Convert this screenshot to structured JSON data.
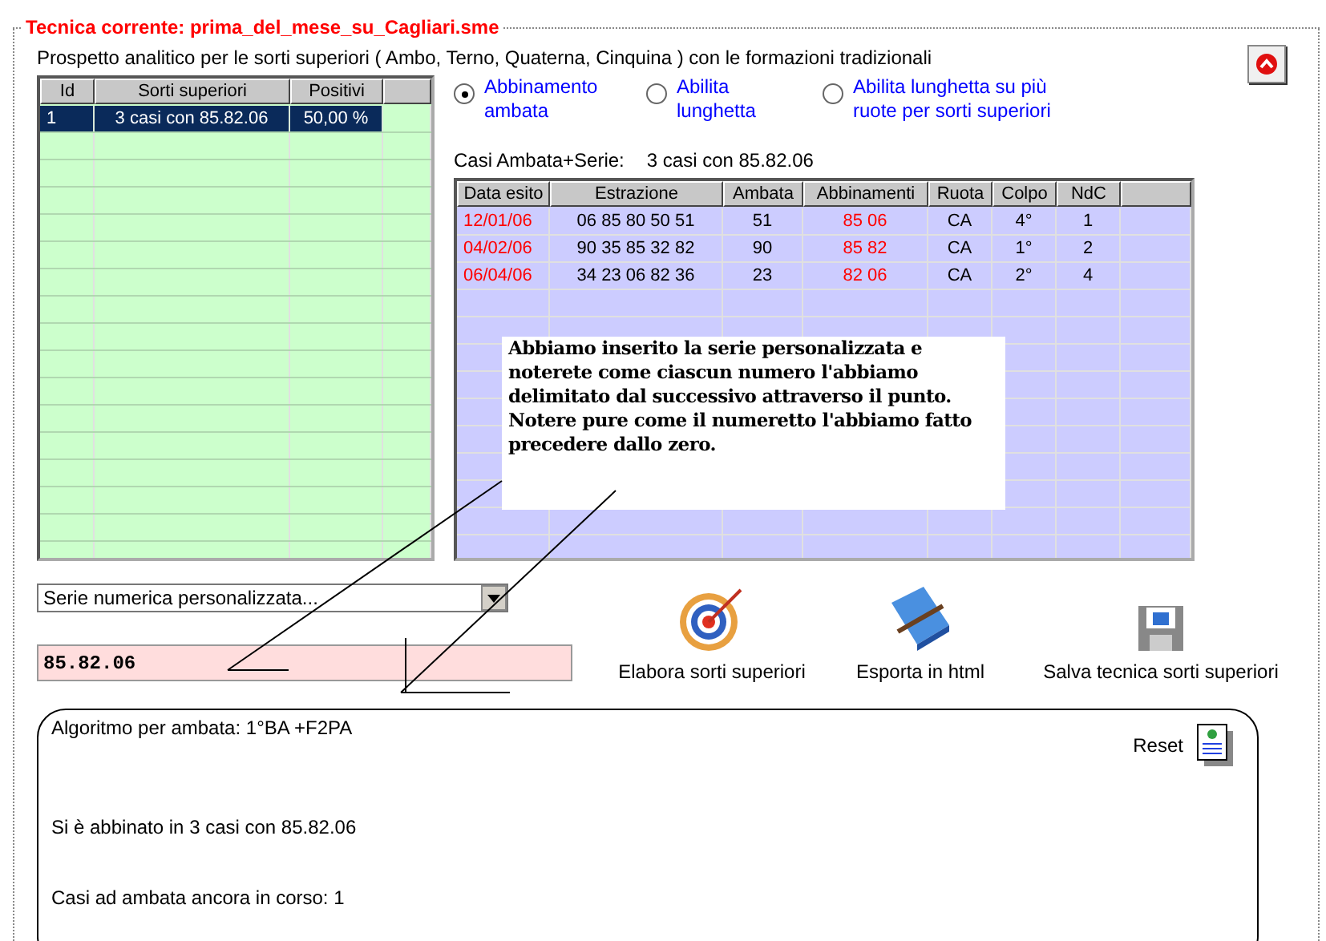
{
  "title": "Tecnica corrente: prima_del_mese_su_Cagliari.sme",
  "description": "Prospetto analitico per le sorti superiori ( Ambo, Terno, Quaterna, Cinquina ) con le formazioni tradizionali",
  "sorti_table": {
    "columns": [
      "Id",
      "Sorti superiori",
      "Positivi"
    ],
    "rows": [
      {
        "cells": [
          "1",
          "3 casi con 85.82.06",
          "50,00 %"
        ],
        "selected": true
      }
    ]
  },
  "options": [
    {
      "label": "Abbinamento ambata",
      "selected": true
    },
    {
      "label": "Abilita lunghetta",
      "selected": false
    },
    {
      "label": "Abilita lunghetta su più ruote per sorti superiori",
      "selected": false
    }
  ],
  "casi": {
    "label": "Casi Ambata+Serie:",
    "value": "3 casi con 85.82.06"
  },
  "results_table": {
    "columns": [
      "Data esito",
      "Estrazione",
      "Ambata",
      "Abbinamenti",
      "Ruota",
      "Colpo",
      "NdC"
    ],
    "rows": [
      {
        "cells": [
          "12/01/06",
          "06 85 80 50 51",
          "51",
          "85 06",
          "CA",
          "4°",
          "1"
        ]
      },
      {
        "cells": [
          "04/02/06",
          "90 35 85 32 82",
          "90",
          "85 82",
          "CA",
          "1°",
          "2"
        ]
      },
      {
        "cells": [
          "06/04/06",
          "34 23 06 82 36",
          "23",
          "82 06",
          "CA",
          "2°",
          "4"
        ]
      }
    ]
  },
  "note": "Abbiamo inserito la serie personalizzata e noterete come ciascun numero l'abbiamo delimitato dal successivo attraverso il punto. Notere pure come il numeretto l'abbiamo fatto precedere dallo zero.",
  "dropdown": {
    "value": "Serie numerica personalizzata..."
  },
  "serie_field": {
    "value": "85.82.06"
  },
  "actions": [
    {
      "label": "Elabora sorti superiori",
      "kind": "target"
    },
    {
      "label": "Esporta in html",
      "kind": "book"
    },
    {
      "label": "Salva tecnica sorti superiori",
      "kind": "floppy"
    }
  ],
  "output": {
    "reset": "Reset",
    "lines": [
      "Algoritmo per ambata: 1°BA +F2PA",
      "Si è abbinato in 3 casi con 85.82.06",
      "Casi ad ambata ancora in corso:  1"
    ]
  }
}
